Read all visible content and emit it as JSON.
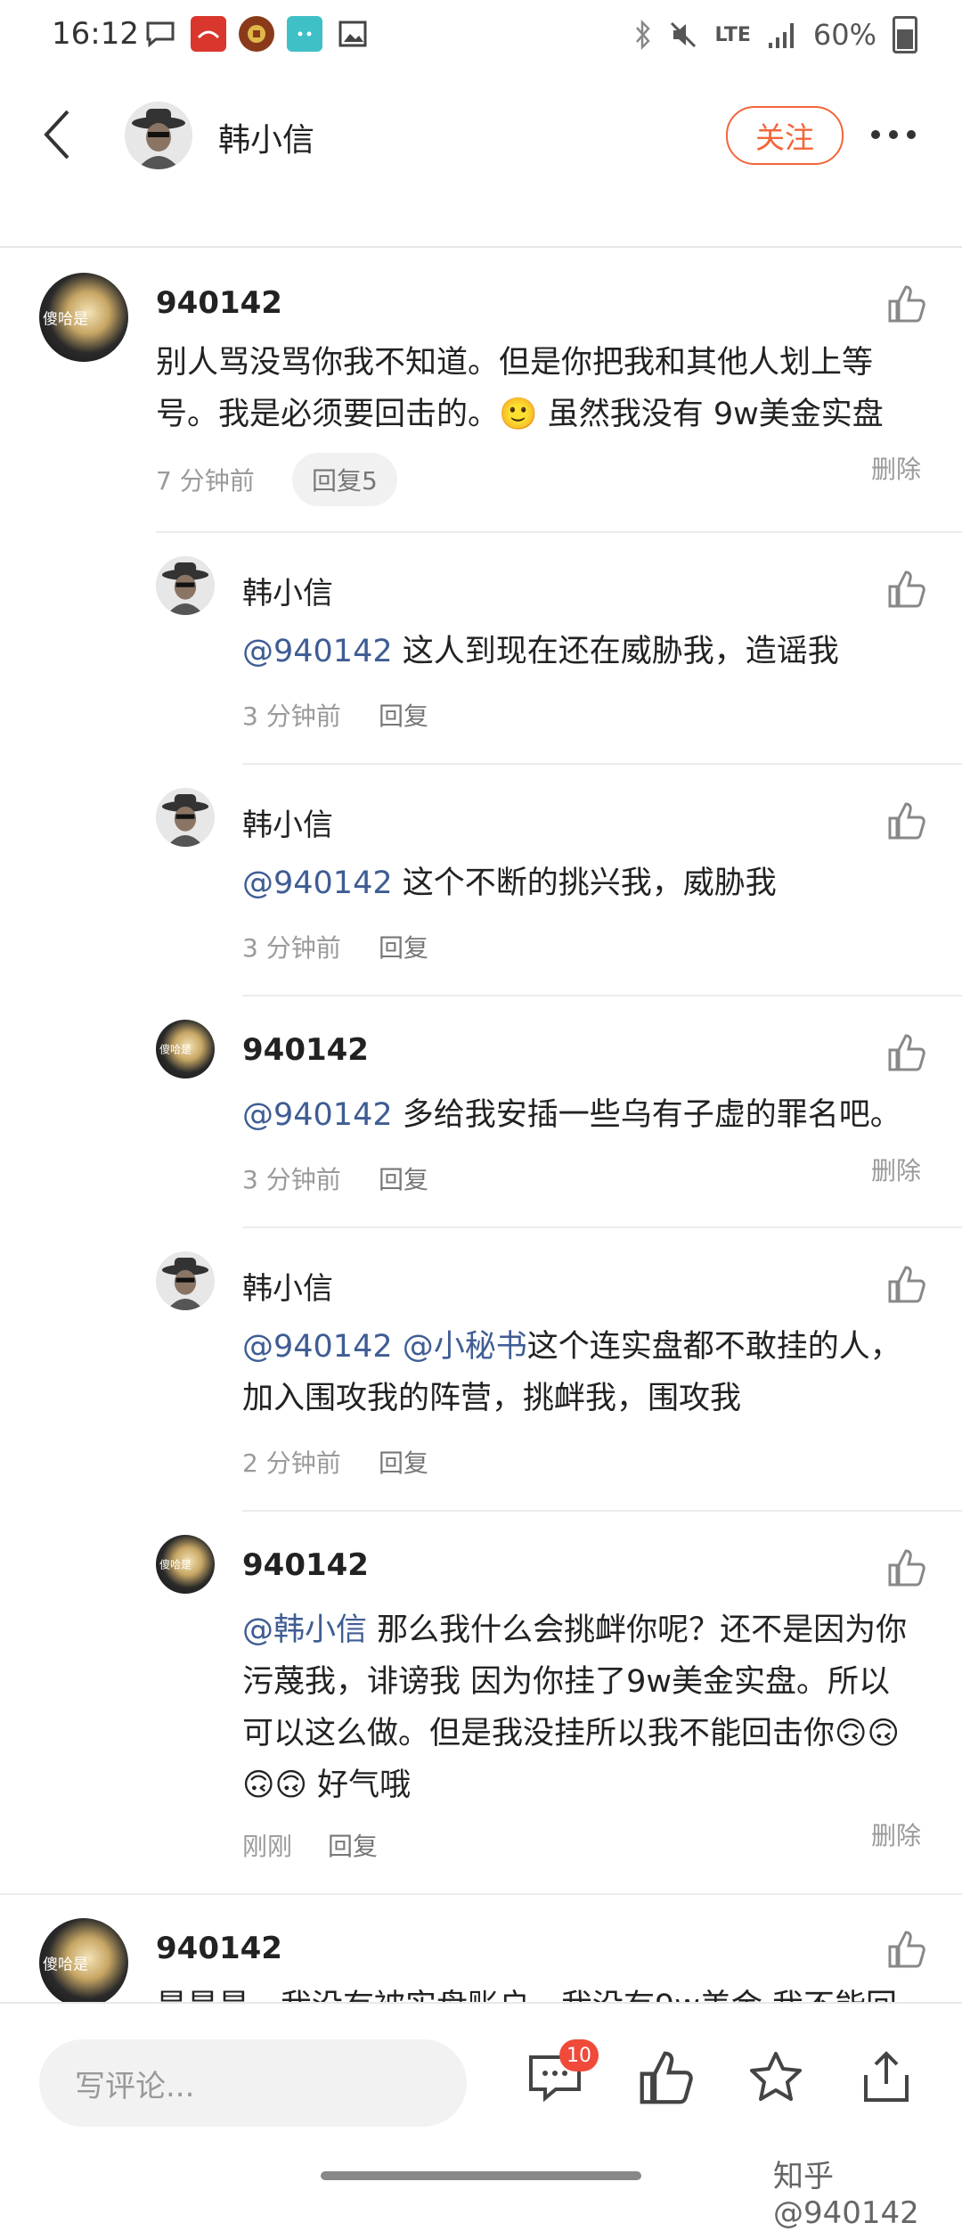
{
  "status_bar": {
    "time": "16:12",
    "network": "LTE",
    "battery": "60%"
  },
  "header": {
    "author_name": "韩小信",
    "follow_label": "关注"
  },
  "comments": [
    {
      "user": "940142",
      "text": "别人骂没骂你我不知道。但是你把我和其他人划上等号。我是必须要回击的。🙂 虽然我没有 9w美金实盘",
      "time": "7 分钟前",
      "reply": "回复5",
      "delete": "删除"
    }
  ],
  "replies": [
    {
      "user": "韩小信",
      "mention": "@940142",
      "text": " 这人到现在还在威胁我，造谣我",
      "time": "3 分钟前",
      "reply": "回复"
    },
    {
      "user": "韩小信",
      "mention": "@940142",
      "text": " 这个不断的挑兴我，威胁我",
      "time": "3 分钟前",
      "reply": "回复"
    },
    {
      "user": "940142",
      "mention": "@940142",
      "text": " 多给我安插一些乌有子虚的罪名吧。",
      "time": "3 分钟前",
      "reply": "回复",
      "delete": "删除"
    },
    {
      "user": "韩小信",
      "mention": "@940142 @小秘书",
      "text": "这个连实盘都不敢挂的人，加入围攻我的阵营，挑衅我，围攻我",
      "time": "2 分钟前",
      "reply": "回复"
    },
    {
      "user": "940142",
      "mention": "@韩小信",
      "text": " 那么我什么会挑衅你呢？还不是因为你污蔑我，诽谤我 因为你挂了9w美金实盘。所以可以这么做。但是我没挂所以我不能回击你🙃🙃🙃🙃 好气哦",
      "time": "刚刚",
      "reply": "回复",
      "delete": "删除"
    }
  ],
  "next_comment": {
    "user": "940142",
    "partial_text": "是是是，我没有被实盘账户，我没有9w美金 我不能回"
  },
  "avatar_text": "傻哈是",
  "bottom_bar": {
    "input_placeholder": "写评论...",
    "comment_badge": "10"
  },
  "watermark": "知乎 @940142",
  "colors": {
    "accent": "#f2663a",
    "mention": "#3f5d94",
    "badge": "#f04a3a"
  },
  "icons": [
    "message-icon",
    "app-icon",
    "coin-icon",
    "chat-icon",
    "image-icon",
    "bluetooth-icon",
    "mute-icon",
    "signal-icon",
    "battery-icon",
    "back-icon",
    "more-icon",
    "thumbs-up-icon",
    "comment-icon",
    "star-icon",
    "share-icon"
  ]
}
